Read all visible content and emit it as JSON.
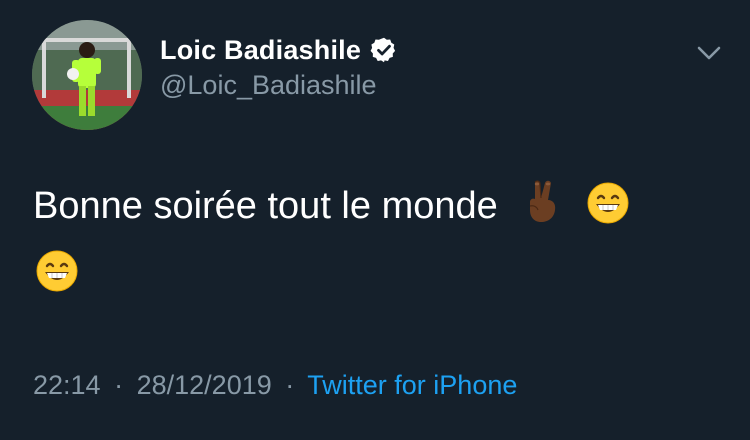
{
  "author": {
    "display_name": "Loic Badiashile",
    "handle": "@Loic_Badiashile",
    "verified": true,
    "avatar": "profile-photo-goalkeeper"
  },
  "tweet": {
    "text": "Bonne soirée tout le monde",
    "emojis": [
      "victory-hand-medium-dark-skin",
      "grinning-face-smiling-eyes",
      "grinning-face-smiling-eyes"
    ]
  },
  "meta": {
    "time": "22:14",
    "date": "28/12/2019",
    "separator": "·",
    "source": "Twitter for iPhone"
  },
  "colors": {
    "background": "#15202b",
    "text_primary": "#ffffff",
    "text_secondary": "#8899a6",
    "link": "#1da1f2",
    "verified_badge": "#ffffff"
  },
  "icons": {
    "more_menu": "chevron-down-icon",
    "verified": "verified-badge-icon"
  }
}
